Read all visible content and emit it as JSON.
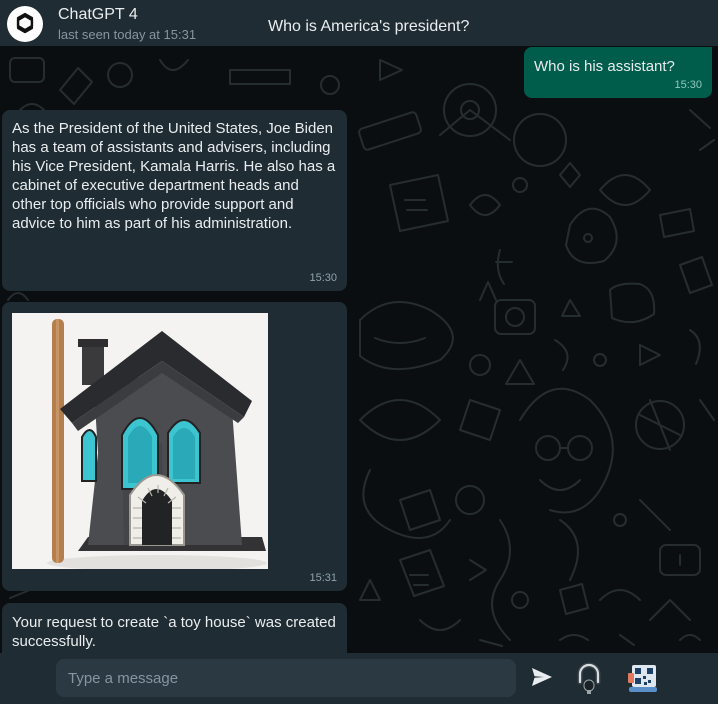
{
  "header": {
    "contact_name": "ChatGPT 4",
    "status": "last seen today at 15:31",
    "chat_title": "Who is America's president?"
  },
  "messages": [
    {
      "direction": "outgoing",
      "text": "Who is his assistant?",
      "time": "15:30"
    },
    {
      "direction": "incoming",
      "text": "As the President of the United States, Joe Biden has a team of assistants and advisers, including his Vice President, Kamala Harris. He also has a cabinet of executive department heads and other top officials who provide support and advice to him as part of his administration.",
      "time": "15:30"
    },
    {
      "direction": "incoming",
      "type": "image",
      "time": "15:31"
    },
    {
      "direction": "incoming",
      "text": "Your request to create `a toy house` was created successfully.",
      "time": ""
    }
  ],
  "composer": {
    "placeholder": "Type a message"
  },
  "icons": {
    "avatar": "openai-logo-icon",
    "send": "send-icon",
    "mic": "mic-icon",
    "extra": "qr-scanner-icon"
  },
  "colors": {
    "header_bg": "#1f2c33",
    "incoming_bubble": "#1f2c33",
    "outgoing_bubble": "#005c4b",
    "chat_bg": "#0b0e11",
    "input_bg": "#2a3942"
  }
}
